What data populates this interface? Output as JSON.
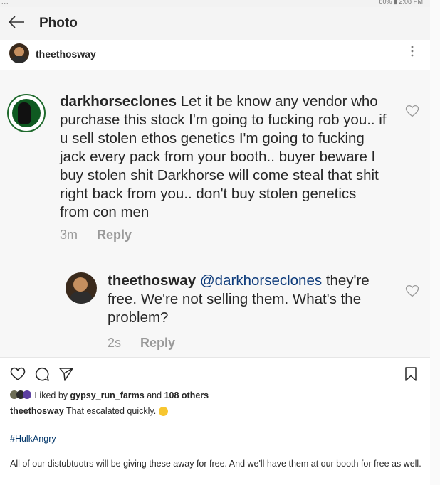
{
  "status": {
    "left": "...",
    "right": "80% ▮ 2:08 PM"
  },
  "header": {
    "title": "Photo"
  },
  "post": {
    "username": "theethosway"
  },
  "comments": [
    {
      "username": "darkhorseclones",
      "text": "Let it be know any vendor who purchase this stock I'm going to fucking rob you.. if u sell stolen ethos genetics I'm going to fucking jack every pack from your booth.. buyer beware I buy stolen shit Darkhorse will come steal that shit right back from you.. don't buy stolen genetics from con men",
      "time": "3m",
      "reply_label": "Reply"
    },
    {
      "username": "theethosway",
      "mention": "@darkhorseclones",
      "text": "they're free.  We're not selling them. What's the problem?",
      "time": "2s",
      "reply_label": "Reply"
    }
  ],
  "likes": {
    "prefix": "Liked by",
    "user": "gypsy_run_farms",
    "middle": "and",
    "others": "108 others"
  },
  "caption": {
    "username": "theethosway",
    "text": "That escalated quickly."
  },
  "hashtag": "#HulkAngry",
  "caption2": "All of our distubtuotrs will be giving these away for free. And we'll have them at our booth for free as well.",
  "colors": {
    "accent_link": "#003569",
    "mention": "#0c3a7a",
    "muted": "#999999"
  }
}
